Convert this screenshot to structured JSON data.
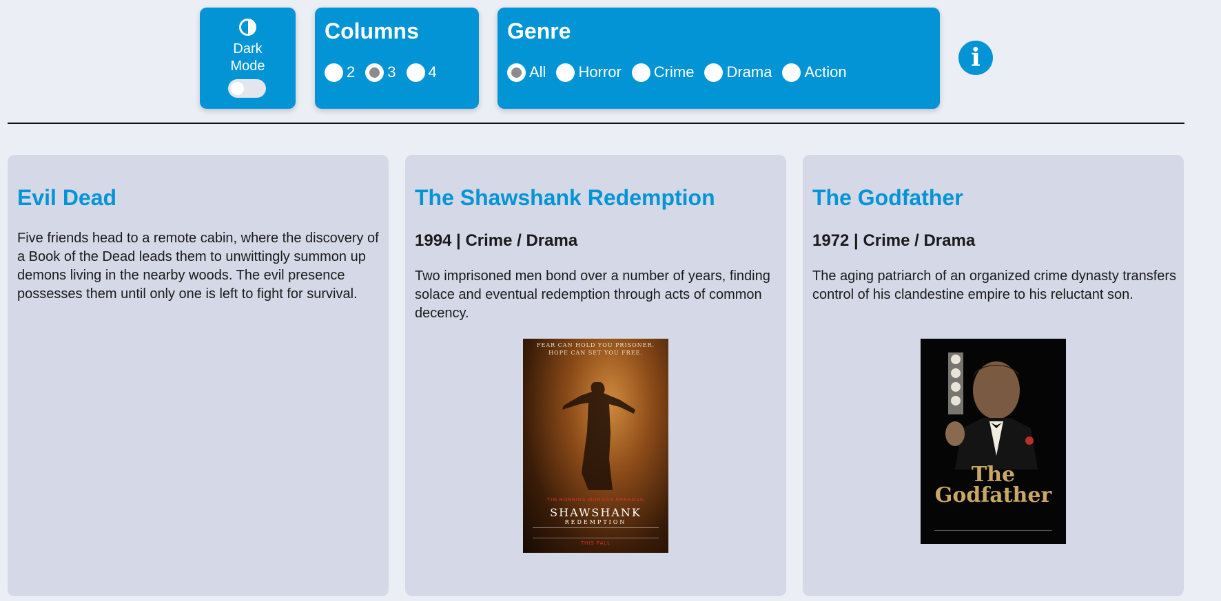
{
  "controls": {
    "dark_mode": {
      "label": "Dark\nMode",
      "icon": "contrast-icon",
      "enabled": false
    },
    "columns": {
      "title": "Columns",
      "options": [
        "2",
        "3",
        "4"
      ],
      "selected": "3"
    },
    "genre": {
      "title": "Genre",
      "options": [
        "All",
        "Horror",
        "Crime",
        "Drama",
        "Action"
      ],
      "selected": "All"
    },
    "info_icon": "info-icon",
    "accent_color": "#0394d6"
  },
  "movies": [
    {
      "title": "Evil Dead",
      "description": "Five friends head to a remote cabin, where the discovery of a Book of the Dead leads them to unwittingly summon up demons living in the nearby woods. The evil presence possesses them until only one is left to fight for survival."
    },
    {
      "title": "The Shawshank Redemption",
      "meta": "1994 | Crime / Drama",
      "description": "Two imprisoned men bond over a number of years, finding solace and eventual redemption through acts of common decency.",
      "poster": {
        "tagline_1": "FEAR CAN HOLD YOU PRISONER.",
        "tagline_2": "HOPE CAN SET YOU FREE.",
        "actors": "TIM ROBBINS   MORGAN FREEMAN",
        "name_1": "SHAWSHANK",
        "name_2": "REDEMPTION",
        "footer": "THIS FALL"
      }
    },
    {
      "title": "The Godfather",
      "meta": "1972 | Crime / Drama",
      "description": "The aging patriarch of an organized crime dynasty transfers control of his clandestine empire to his reluctant son.",
      "poster": {
        "title": "The\nGodfather"
      }
    }
  ]
}
